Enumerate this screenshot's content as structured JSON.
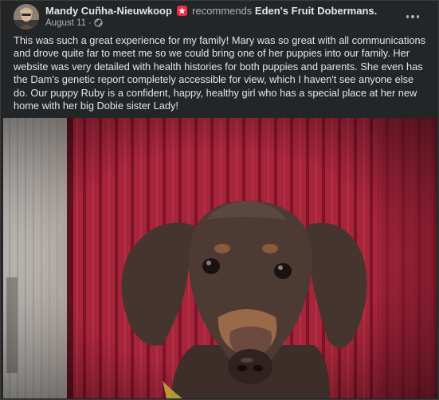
{
  "post": {
    "author": "Mandy Cuñha-Nieuwkoop",
    "recommends_label": "recommends",
    "page_name": "Eden's Fruit Dobermans.",
    "date": "August 11",
    "dot": "·",
    "text": "This was such a great experience for my family! Mary was so great with all communications and drove quite far to meet me so we could bring one of her puppies into our family. Her website was very detailed with health histories for both puppies and parents. She even has the Dam's genetic report completely accessible for view, which I haven't see anyone else do. Our puppy Ruby is a confident, happy, healthy girl who has a special place at her new home with her big Dobie sister Lady!"
  },
  "icons": {
    "badge": "recommendation-badge-icon",
    "privacy": "globe-icon",
    "menu": "more-options-icon"
  },
  "colors": {
    "card_bg": "#242526",
    "badge": "#f02849",
    "secondary_text": "#b0b3b8",
    "wall_red": "#a8243a"
  }
}
